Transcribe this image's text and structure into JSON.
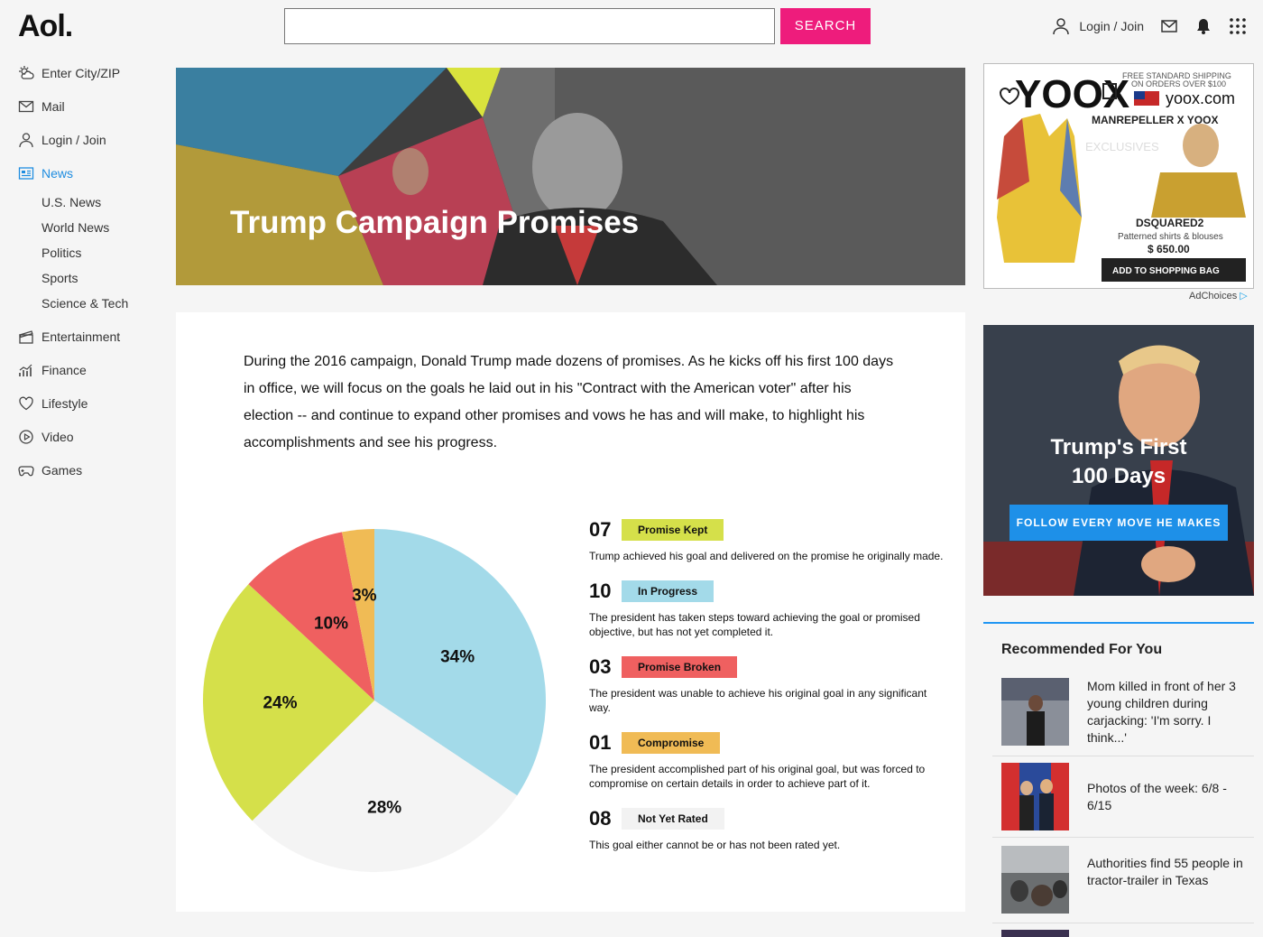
{
  "header": {
    "logo": "Aol.",
    "search_placeholder": "",
    "search_label": "SEARCH",
    "login_label": "Login / Join"
  },
  "sidebar": {
    "items": [
      {
        "label": "Enter City/ZIP",
        "icon": "weather-icon"
      },
      {
        "label": "Mail",
        "icon": "mail-icon"
      },
      {
        "label": "Login / Join",
        "icon": "user-icon"
      },
      {
        "label": "News",
        "icon": "news-icon",
        "active": true
      },
      {
        "label": "Entertainment",
        "icon": "clapper-icon"
      },
      {
        "label": "Finance",
        "icon": "chart-icon"
      },
      {
        "label": "Lifestyle",
        "icon": "heart-icon"
      },
      {
        "label": "Video",
        "icon": "play-icon"
      },
      {
        "label": "Games",
        "icon": "gamepad-icon"
      }
    ],
    "news_sub": [
      "U.S. News",
      "World News",
      "Politics",
      "Sports",
      "Science & Tech"
    ]
  },
  "hero": {
    "title": "Trump Campaign Promises"
  },
  "intro": "During the 2016 campaign, Donald Trump made dozens of promises. As he kicks off his first 100 days in office, we will focus on the goals he laid out in his \"Contract with the American voter\" after his election -- and continue to expand other promises and vows he has and will make, to highlight his accomplishments and see his progress.",
  "chart_data": {
    "type": "pie",
    "slices": [
      {
        "label": "34%",
        "value": 34,
        "color": "#a3dae9"
      },
      {
        "label": "28%",
        "value": 28,
        "color": "#f4f4f4"
      },
      {
        "label": "24%",
        "value": 24,
        "color": "#d5e04a"
      },
      {
        "label": "10%",
        "value": 10,
        "color": "#ef6060"
      },
      {
        "label": "3%",
        "value": 3,
        "color": "#f0bb55"
      }
    ]
  },
  "legend": [
    {
      "count": "07",
      "label": "Promise Kept",
      "color": "#d5e04a",
      "desc": "Trump achieved his goal and delivered on the promise he originally made."
    },
    {
      "count": "10",
      "label": "In Progress",
      "color": "#a3dae9",
      "desc": "The president has taken steps toward achieving the goal or promised objective, but has not yet completed it."
    },
    {
      "count": "03",
      "label": "Promise Broken",
      "color": "#ef6060",
      "desc": "The president was unable to achieve his original goal in any significant way."
    },
    {
      "count": "01",
      "label": "Compromise",
      "color": "#f0bb55",
      "desc": "The president accomplished part of his original goal, but was forced to compromise on certain details in order to achieve part of it."
    },
    {
      "count": "08",
      "label": "Not Yet Rated",
      "color": "#f2f2f2",
      "desc": "This goal either cannot be or has not been rated yet."
    }
  ],
  "ad": {
    "brand": "YOOX",
    "shipping_line1": "FREE STANDARD SHIPPING",
    "shipping_line2": "ON ORDERS OVER $100",
    "site": "yoox.com",
    "collab": "MANREPELLER X YOOX",
    "exclusives": "EXCLUSIVES",
    "product_brand": "DSQUARED2",
    "product_desc": "Patterned shirts & blouses",
    "price": "$ 650.00",
    "cta": "ADD TO SHOPPING BAG",
    "adchoices": "AdChoices"
  },
  "promo": {
    "title_line1": "Trump's First",
    "title_line2": "100 Days",
    "button": "FOLLOW EVERY MOVE HE MAKES"
  },
  "recommended": {
    "title": "Recommended For You",
    "items": [
      {
        "text": "Mom killed in front of her 3 young children during carjacking: 'I'm sorry. I think...'"
      },
      {
        "text": "Photos of the week: 6/8 - 6/15"
      },
      {
        "text": "Authorities find 55 people in tractor-trailer in Texas"
      }
    ]
  }
}
